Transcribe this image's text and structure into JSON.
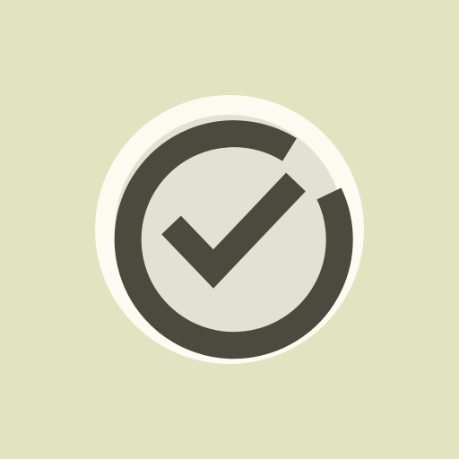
{
  "icon": {
    "name": "check-circle-icon",
    "colors": {
      "background": "#e2e3c1",
      "outer_ring": "#fdfbf1",
      "inner_fill": "#e2e2d3",
      "stroke": "#4a4a3e"
    }
  }
}
